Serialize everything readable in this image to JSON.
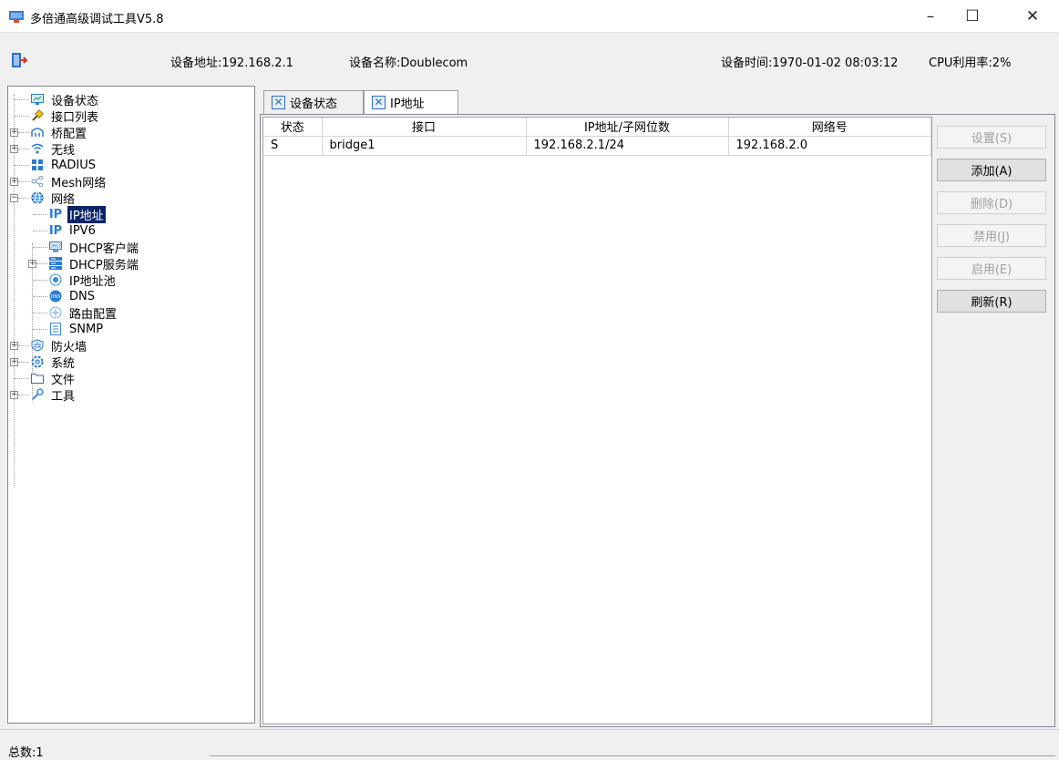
{
  "window": {
    "title": "多倍通高级调试工具V5.8",
    "minimize_glyph": "–",
    "maximize_glyph": "☐",
    "close_glyph": "✕"
  },
  "info": {
    "device_address": "设备地址:192.168.2.1",
    "device_name": "设备名称:Doublecom",
    "device_time": "设备时间:1970-01-02 08:03:12",
    "cpu_usage": "CPU利用率:2%"
  },
  "tree": {
    "items": [
      {
        "label": "设备状态",
        "icon": "monitor-icon"
      },
      {
        "label": "接口列表",
        "icon": "plug-icon"
      },
      {
        "label": "桥配置",
        "icon": "bridge-icon"
      },
      {
        "label": "无线",
        "icon": "wifi-icon"
      },
      {
        "label": "RADIUS",
        "icon": "radius-icon"
      },
      {
        "label": "Mesh网络",
        "icon": "share-icon"
      },
      {
        "label": "网络",
        "icon": "globe-icon"
      },
      {
        "label": "IP地址",
        "icon": "ip-icon"
      },
      {
        "label": "IPV6",
        "icon": "ip-icon"
      },
      {
        "label": "DHCP客户端",
        "icon": "dhcp-client-icon"
      },
      {
        "label": "DHCP服务端",
        "icon": "dhcp-server-icon"
      },
      {
        "label": "IP地址池",
        "icon": "pool-icon"
      },
      {
        "label": "DNS",
        "icon": "dns-icon"
      },
      {
        "label": "路由配置",
        "icon": "route-icon"
      },
      {
        "label": "SNMP",
        "icon": "snmp-icon"
      },
      {
        "label": "防火墙",
        "icon": "firewall-icon"
      },
      {
        "label": "系统",
        "icon": "gear-icon"
      },
      {
        "label": "文件",
        "icon": "folder-icon"
      },
      {
        "label": "工具",
        "icon": "wrench-icon"
      }
    ]
  },
  "tabs": [
    {
      "label": "设备状态"
    },
    {
      "label": "IP地址"
    }
  ],
  "table": {
    "columns": [
      "状态",
      "接口",
      "IP地址/子网位数",
      "网络号"
    ],
    "rows": [
      [
        "S",
        "bridge1",
        "192.168.2.1/24",
        "192.168.2.0"
      ]
    ]
  },
  "buttons": {
    "set": "设置(S)",
    "add": "添加(A)",
    "delete": "删除(D)",
    "disable": "禁用(J)",
    "enable": "启用(E)",
    "refresh": "刷新(R)"
  },
  "status": {
    "total": "总数:1"
  },
  "colors": {
    "selection": "#0a246a",
    "tab_close_blue": "#2d6bc7"
  }
}
